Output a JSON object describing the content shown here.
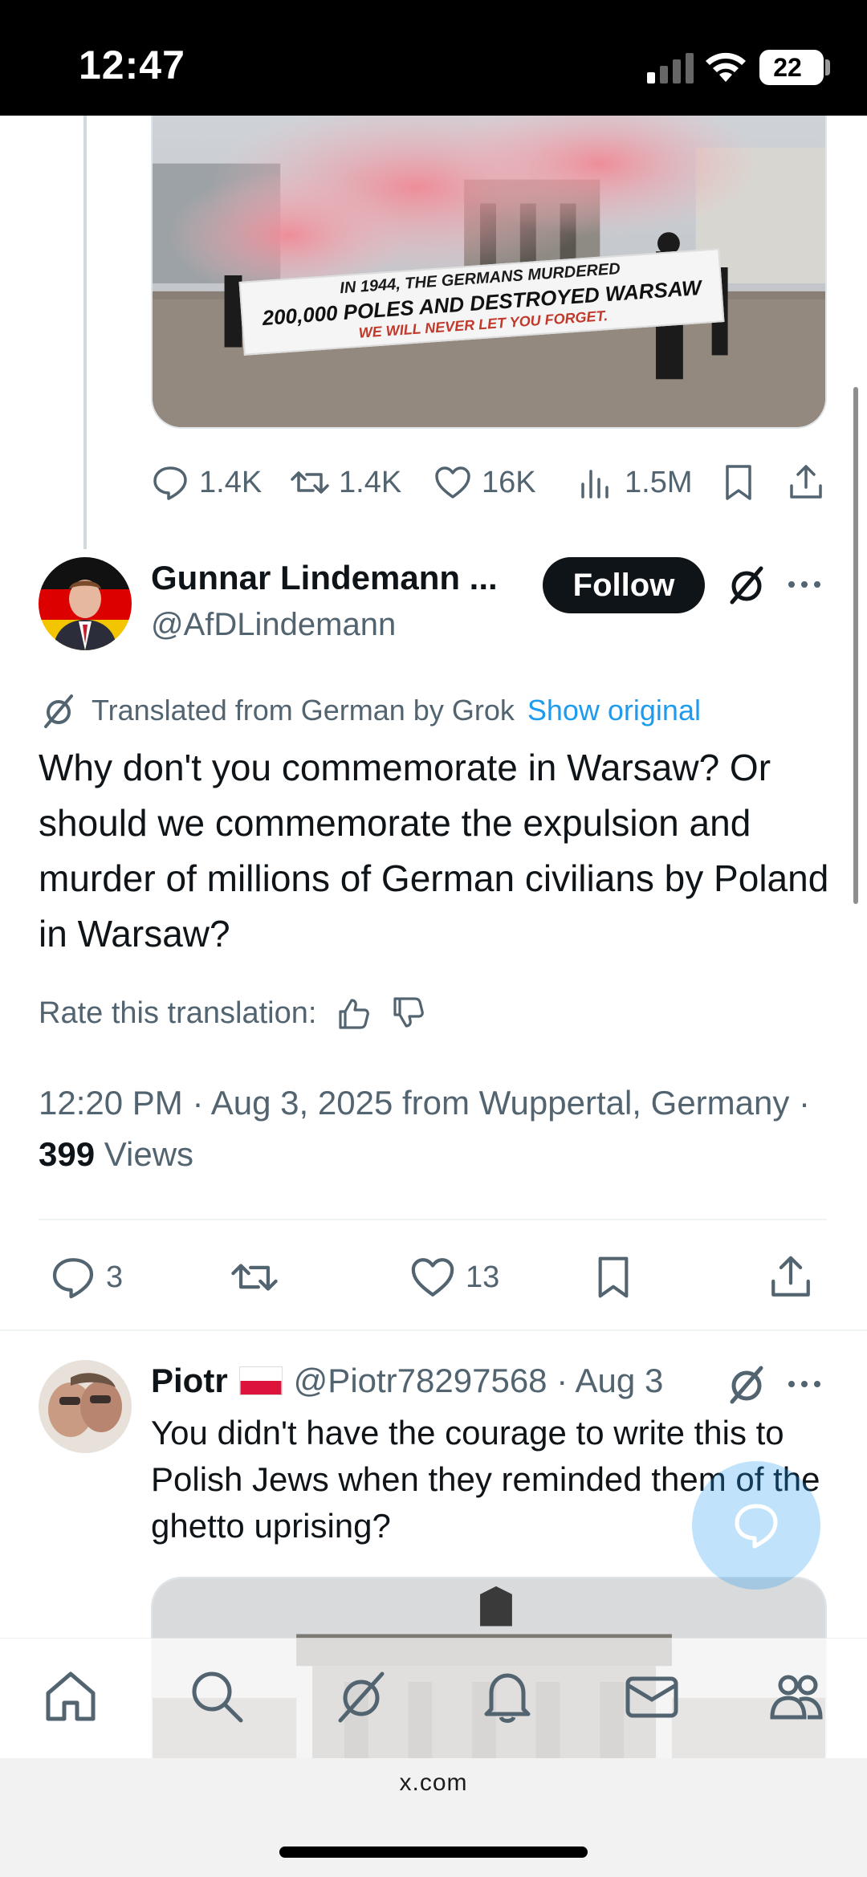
{
  "status_bar": {
    "time": "12:47",
    "battery_level": "22"
  },
  "quoted_media": {
    "banner_line1": "IN 1944, THE GERMANS MURDERED",
    "banner_line2": "200,000 POLES AND DESTROYED WARSAW",
    "banner_line3": "WE WILL NEVER LET YOU FORGET."
  },
  "first_tweet_actions": {
    "replies": "1.4K",
    "reposts": "1.4K",
    "likes": "16K",
    "views": "1.5M"
  },
  "main_tweet": {
    "author_name": "Gunnar Lindemann ...",
    "handle": "@AfDLindemann",
    "follow_label": "Follow",
    "translated_label": "Translated from German by Grok",
    "show_original_label": "Show original",
    "text": "Why don't you commemorate in Warsaw? Or should we commemorate the expulsion and murder of millions of German civilians by Poland in Warsaw?",
    "rate_label": "Rate this translation:",
    "meta_prefix": "12:20 PM · Aug 3, 2025 from Wuppertal, Germany · ",
    "views_count": "399",
    "views_label": " Views",
    "replies": "3",
    "likes": "13"
  },
  "reply": {
    "author_name": "Piotr",
    "handle_date": "@Piotr78297568 · Aug 3",
    "text": "You didn't have the courage to write this to Polish Jews when they reminded them of the ghetto uprising?"
  },
  "icons": {
    "reply": "reply-icon",
    "repost": "repost-icon",
    "like": "heart-icon",
    "views": "views-icon",
    "bookmark": "bookmark-icon",
    "share": "share-icon",
    "grok": "grok-icon",
    "more": "more-icon",
    "home": "home-icon",
    "search": "search-icon",
    "notifications": "bell-icon",
    "messages": "mail-icon",
    "communities": "communities-icon",
    "compose": "compose-chat-icon"
  },
  "browser": {
    "url": "x.com"
  },
  "colors": {
    "accent": "#1d9bf0",
    "text": "#0f1419",
    "secondary": "#536471"
  }
}
